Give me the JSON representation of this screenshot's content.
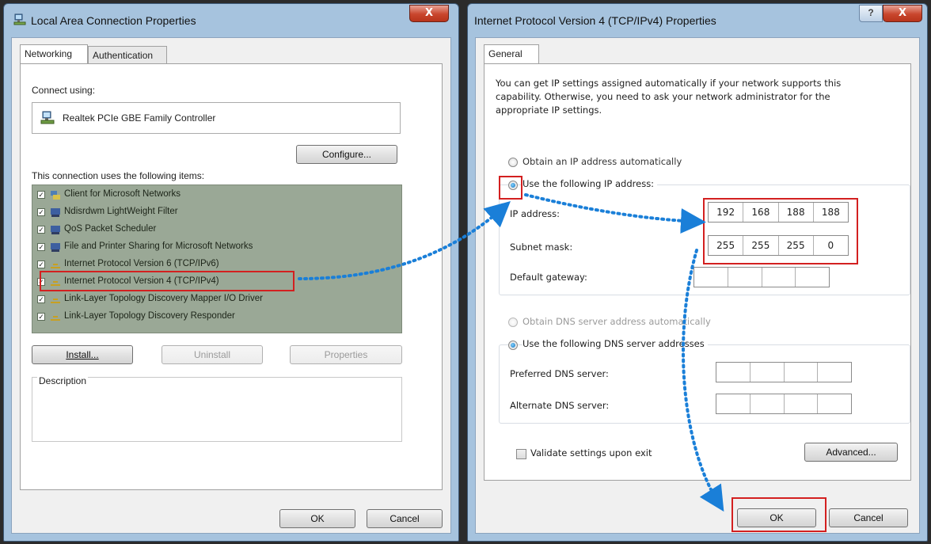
{
  "lan": {
    "title": "Local Area Connection Properties",
    "close": "X",
    "tabs": [
      "Networking",
      "Authentication"
    ],
    "connect_using_label": "Connect using:",
    "adapter": "Realtek PCIe GBE Family Controller",
    "configure": "Configure...",
    "items_label": "This connection uses the following items:",
    "items": [
      "Client for Microsoft Networks",
      "Ndisrdwm LightWeight Filter",
      "QoS Packet Scheduler",
      "File and Printer Sharing for Microsoft Networks",
      "Internet Protocol Version 6 (TCP/IPv6)",
      "Internet Protocol Version 4 (TCP/IPv4)",
      "Link-Layer Topology Discovery Mapper I/O Driver",
      "Link-Layer Topology Discovery Responder"
    ],
    "check": "✓",
    "install": "Install...",
    "uninstall": "Uninstall",
    "properties": "Properties",
    "description_label": "Description",
    "ok": "OK",
    "cancel": "Cancel"
  },
  "ipv4": {
    "title": "Internet Protocol Version 4 (TCP/IPv4) Properties",
    "help": "?",
    "close": "X",
    "tab": "General",
    "intro": "You can get IP settings assigned automatically if your network supports this capability. Otherwise, you need to ask your network administrator for the appropriate IP settings.",
    "obtain_ip": "Obtain an IP address automatically",
    "use_ip": "Use the following IP address:",
    "ip_label": "IP address:",
    "ip": [
      "192",
      "168",
      "188",
      "188"
    ],
    "subnet_label": "Subnet mask:",
    "subnet": [
      "255",
      "255",
      "255",
      "0"
    ],
    "gateway_label": "Default gateway:",
    "gateway": [
      "",
      "",
      "",
      ""
    ],
    "obtain_dns": "Obtain DNS server address automatically",
    "use_dns": "Use the following DNS server addresses",
    "preferred_label": "Preferred DNS server:",
    "preferred": [
      "",
      "",
      "",
      ""
    ],
    "alternate_label": "Alternate DNS server:",
    "alternate": [
      "",
      "",
      "",
      ""
    ],
    "validate": "Validate settings upon exit",
    "advanced": "Advanced...",
    "ok": "OK",
    "cancel": "Cancel"
  },
  "colors": {
    "highlight_border": "#d32020",
    "arrow": "#1a7fd8",
    "list_background": "#9aa896"
  }
}
